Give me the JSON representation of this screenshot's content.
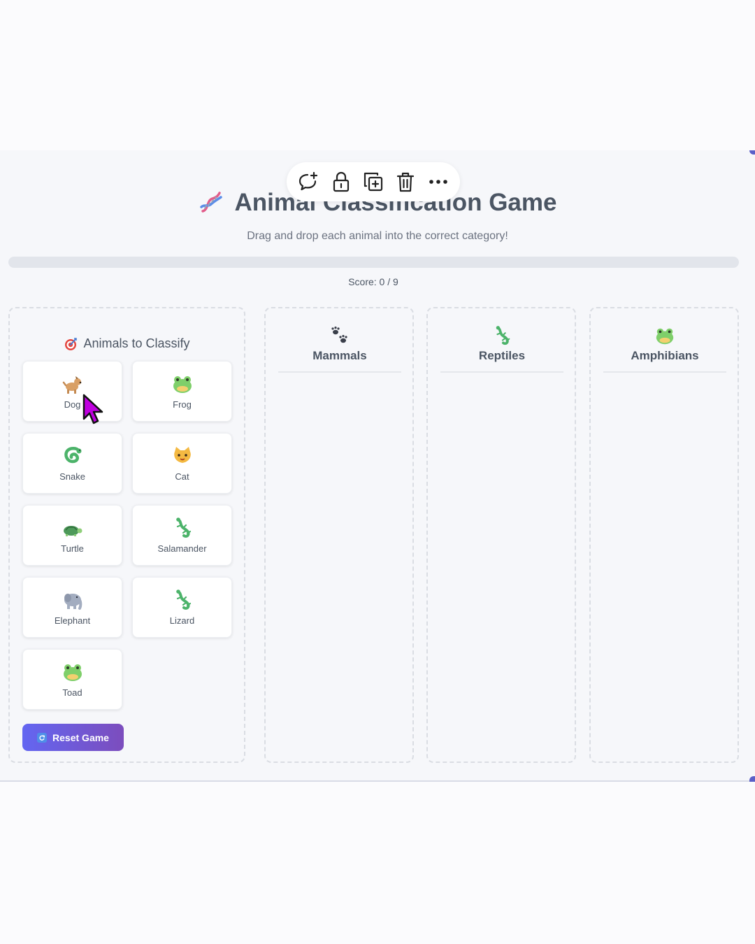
{
  "toolbar": {
    "buttons": [
      "comment-add-icon",
      "lock-icon",
      "duplicate-icon",
      "trash-icon",
      "more-icon"
    ]
  },
  "header": {
    "title": "Animal Classification Game",
    "subtitle": "Drag and drop each animal into the correct category!",
    "score": "Score: 0 / 9"
  },
  "progress": {
    "fraction": 0
  },
  "source": {
    "title": "Animals to Classify",
    "animals": [
      {
        "label": "Dog",
        "icon": "dog-icon"
      },
      {
        "label": "Frog",
        "icon": "frog-icon"
      },
      {
        "label": "Snake",
        "icon": "snake-icon"
      },
      {
        "label": "Cat",
        "icon": "cat-icon"
      },
      {
        "label": "Turtle",
        "icon": "turtle-icon"
      },
      {
        "label": "Salamander",
        "icon": "lizard-icon"
      },
      {
        "label": "Elephant",
        "icon": "elephant-icon"
      },
      {
        "label": "Lizard",
        "icon": "lizard-icon"
      },
      {
        "label": "Toad",
        "icon": "frog-icon"
      }
    ],
    "reset_label": "Reset Game"
  },
  "categories": [
    {
      "title": "Mammals",
      "icon": "paw-prints-icon"
    },
    {
      "title": "Reptiles",
      "icon": "lizard-icon"
    },
    {
      "title": "Amphibians",
      "icon": "frog-icon"
    }
  ],
  "colors": {
    "accent": "#6366f1",
    "accent_end": "#7c4dbd",
    "frame_corner": "#5b5fc7",
    "cursor": "#c000e0"
  }
}
